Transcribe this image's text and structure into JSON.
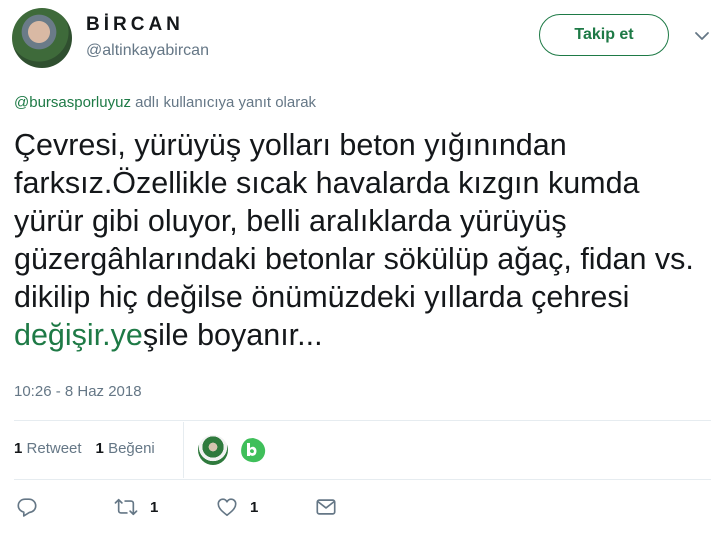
{
  "author": {
    "display_name": "BİRCAN",
    "handle": "@altinkayabircan"
  },
  "follow_button": {
    "label": "Takip et"
  },
  "reply_context": {
    "mention": "@bursasporluyuz",
    "text": " adlı kullanıcıya yanıt olarak"
  },
  "tweet": {
    "text_before_link": "Çevresi, yürüyüş yolları beton yığınından farksız.Özellikle sıcak havalarda kızgın kumda yürür gibi oluyor, belli aralıklarda yürüyüş güzergâhlarındaki betonlar sökülüp ağaç, fidan vs. dikilip hiç değilse önümüzdeki yıllarda çehresi  ",
    "link_text": "değişir.ye",
    "text_after_link": "şile boyanır..."
  },
  "timestamp": "10:26 - 8 Haz 2018",
  "stats": {
    "retweet_count": "1",
    "retweet_label": "Retweet",
    "like_count": "1",
    "like_label": "Beğeni"
  },
  "actions": {
    "retweet_count": "1",
    "like_count": "1"
  },
  "colors": {
    "accent": "#1e7a46",
    "secondary_text": "#657786",
    "divider": "#e6ecf0"
  },
  "icons": [
    "chevron-down-icon",
    "reply-icon",
    "retweet-icon",
    "heart-icon",
    "dm-envelope-icon"
  ]
}
